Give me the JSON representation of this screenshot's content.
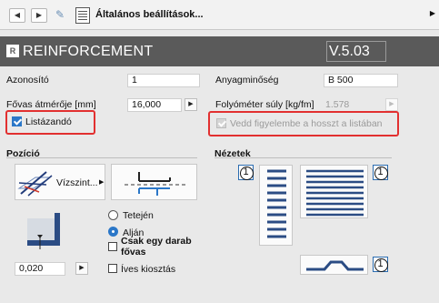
{
  "nav": {
    "title": "Általános beállítások..."
  },
  "header": {
    "title": "REINFORCEMENT",
    "version": "V.5.03",
    "logo_text": "R"
  },
  "fields": {
    "azonosito": {
      "label": "Azonosító",
      "value": "1"
    },
    "anyagminoseg": {
      "label": "Anyagminőség",
      "value": "B 500"
    },
    "fovas_atmeroje": {
      "label": "Fővas átmérője [mm]",
      "value": "16,000"
    },
    "folyometer_suly": {
      "label": "Folyóméter súly [kg/fm]",
      "value": "1.578"
    }
  },
  "checks": {
    "listazando": {
      "label": "Listázandó",
      "checked": true
    },
    "vedd_figyelembe": {
      "label": "Vedd figyelembe a hosszt a listában",
      "checked": true,
      "disabled": true
    }
  },
  "pozicio": {
    "title": "Pozíció",
    "selector_label": "Vízszint...",
    "radio_tetejen": "Tetején",
    "radio_aljan": "Alján",
    "check_csak_egy": "Csak egy darab fővas",
    "check_ives": "Íves kiosztás",
    "offset_value": "0,020"
  },
  "nezetek": {
    "title": "Nézetek",
    "badge": "1"
  },
  "colors": {
    "accent": "#2b77c8",
    "highlight": "#e23030",
    "header_bg": "#5a5a5a"
  }
}
